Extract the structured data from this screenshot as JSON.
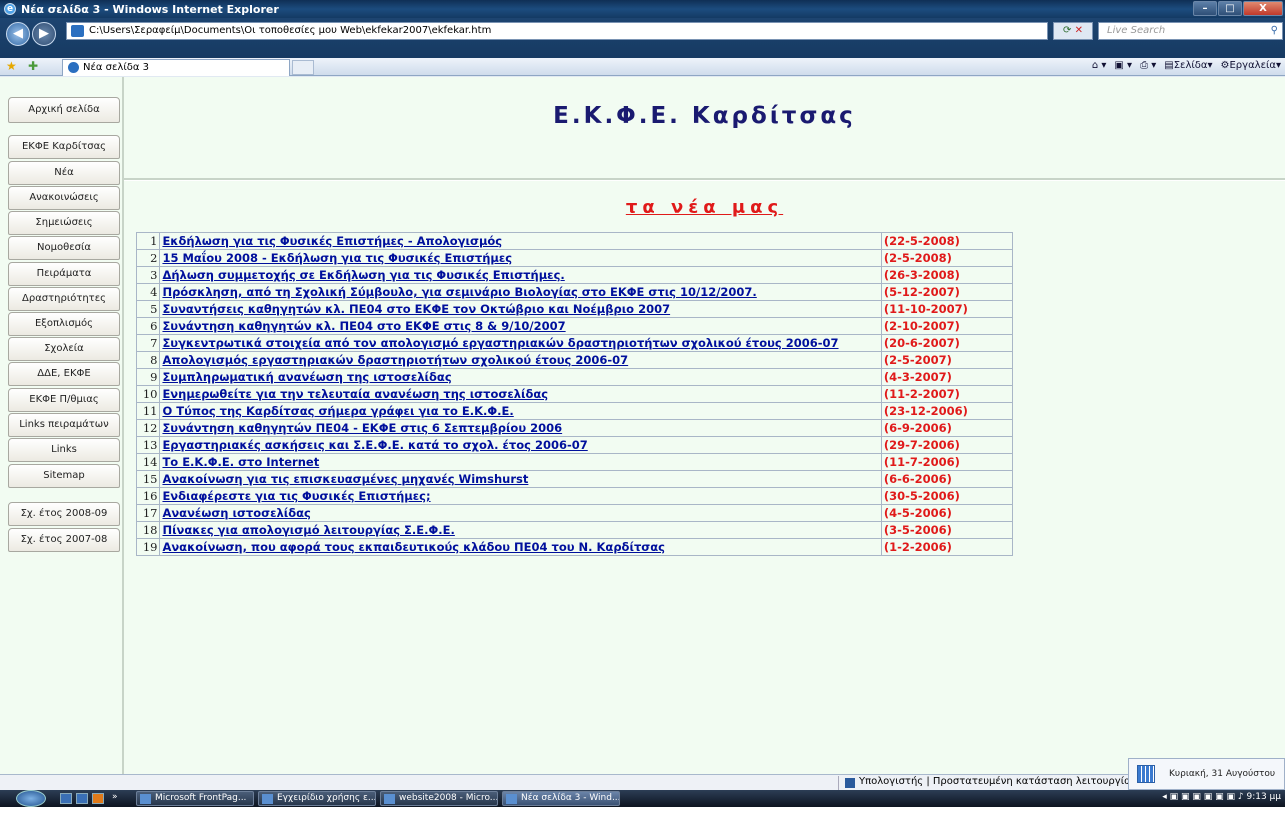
{
  "window": {
    "title": "Νέα σελίδα 3 - Windows Internet Explorer",
    "min": "–",
    "max": "□",
    "close": "X"
  },
  "addressbar": {
    "url": "C:\\Users\\Σεραφείμ\\Documents\\Οι τοποθεσίες μου Web\\ekfekar2007\\ekfekar.htm",
    "search_placeholder": "Live Search"
  },
  "tab": {
    "label": "Νέα σελίδα 3"
  },
  "commandbar": {
    "page": "Σελίδα",
    "tools": "Εργαλεία"
  },
  "nav": [
    "Αρχική σελίδα",
    "ΕΚΦΕ Καρδίτσας",
    "Νέα",
    "Ανακοινώσεις",
    "Σημειώσεις",
    "Νομοθεσία",
    "Πειράματα",
    "Δραστηριότητες",
    "Εξοπλισμός",
    "Σχολεία",
    "ΔΔΕ, ΕΚΦΕ",
    "ΕΚΦΕ Π/θμιας",
    "Links πειραμάτων",
    "Links",
    "Sitemap",
    "Σχ. έτος 2008-09",
    "Σχ. έτος 2007-08"
  ],
  "site_title": "Ε.Κ.Φ.Ε. Καρδίτσας",
  "news_title": "τα νέα μας",
  "news": [
    {
      "n": "1",
      "title": "Εκδήλωση για τις Φυσικές Επιστήμες - Απολογισμός",
      "date": "(22-5-2008)"
    },
    {
      "n": "2",
      "title": "15 Μαΐου 2008 - Εκδήλωση για τις Φυσικές Επιστήμες",
      "date": "(2-5-2008)"
    },
    {
      "n": "3",
      "title": "Δήλωση συμμετοχής σε Εκδήλωση για τις Φυσικές Επιστήμες.",
      "date": "(26-3-2008)"
    },
    {
      "n": "4",
      "title": "Πρόσκληση, από τη Σχολική Σύμβουλο, για σεμινάριο Βιολογίας στο ΕΚΦΕ στις 10/12/2007.",
      "date": "(5-12-2007)"
    },
    {
      "n": "5",
      "title": "Συναντήσεις καθηγητών κλ. ΠΕ04 στο ΕΚΦΕ τον Οκτώβριο και Νοέμβριο 2007",
      "date": "(11-10-2007)"
    },
    {
      "n": "6",
      "title": "Συνάντηση καθηγητών κλ. ΠΕ04 στο ΕΚΦΕ στις 8 & 9/10/2007",
      "date": "(2-10-2007)"
    },
    {
      "n": "7",
      "title": "Συγκεντρωτικά στοιχεία από τον απολογισμό εργαστηριακών δραστηριοτήτων σχολικού έτους 2006-07",
      "date": "(20-6-2007)"
    },
    {
      "n": "8",
      "title": "Απολογισμός εργαστηριακών δραστηριοτήτων σχολικού έτους 2006-07",
      "date": "(2-5-2007)"
    },
    {
      "n": "9",
      "title": "Συμπληρωματική ανανέωση της ιστοσελίδας",
      "date": "(4-3-2007)"
    },
    {
      "n": "10",
      "title": "Ενημερωθείτε για την τελευταία ανανέωση της ιστοσελίδας",
      "date": "(11-2-2007)"
    },
    {
      "n": "11",
      "title": "Ο Τύπος της Καρδίτσας σήμερα γράφει για το Ε.Κ.Φ.Ε.",
      "date": "(23-12-2006)"
    },
    {
      "n": "12",
      "title": "Συνάντηση καθηγητών ΠΕ04 - ΕΚΦΕ στις 6 Σεπτεμβρίου 2006",
      "date": "(6-9-2006)"
    },
    {
      "n": "13",
      "title": "Εργαστηριακές ασκήσεις και Σ.Ε.Φ.Ε. κατά το σχολ. έτος 2006-07",
      "date": "(29-7-2006)"
    },
    {
      "n": "14",
      "title": "Το Ε.Κ.Φ.Ε. στο Internet",
      "date": "(11-7-2006)"
    },
    {
      "n": "15",
      "title": "Ανακοίνωση για τις επισκευασμένες μηχανές Wimshurst",
      "date": "(6-6-2006)"
    },
    {
      "n": "16",
      "title": "Ενδιαφέρεστε για τις Φυσικές Επιστήμες;",
      "date": "(30-5-2006)"
    },
    {
      "n": "17",
      "title": "Ανανέωση ιστοσελίδας",
      "date": "(4-5-2006)"
    },
    {
      "n": "18",
      "title": "Πίνακες για απολογισμό λειτουργίας Σ.Ε.Φ.Ε.",
      "date": "(3-5-2006)"
    },
    {
      "n": "19",
      "title": "Ανακοίνωση, που αφορά τους εκπαιδευτικούς κλάδου ΠΕ04 του Ν. Καρδίτσας",
      "date": "(1-2-2006)"
    }
  ],
  "status": {
    "zone": "Υπολογιστής | Προστατευμένη κατάσταση λειτουργίας: Ανενεργή",
    "date_tooltip": "Κυριακή, 31 Αυγούστου 2008"
  },
  "taskbar": {
    "items": [
      "Microsoft FrontPag...",
      "Εγχειρίδιο χρήσης ε...",
      "website2008 - Micro...",
      "Νέα σελίδα 3 - Wind..."
    ],
    "clock": "9:13 μμ"
  }
}
